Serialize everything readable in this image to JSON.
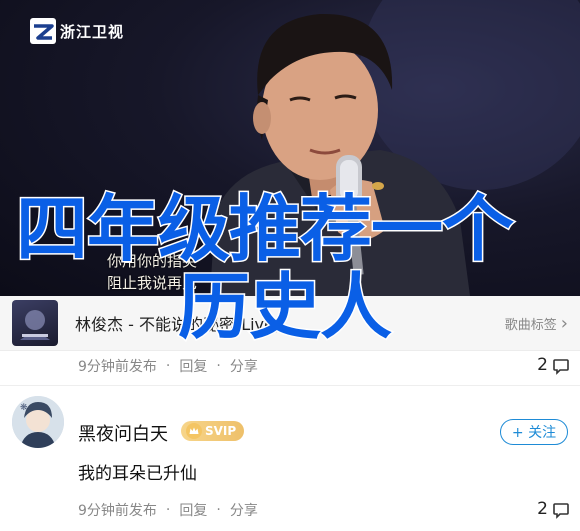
{
  "hero": {
    "logo_text": "浙江卫视",
    "subtitle_line1": "你用你的指尖",
    "subtitle_line2": "阻止我说再见",
    "headline_line1": "四年级推荐一个",
    "headline_line2": "历史人"
  },
  "music": {
    "title": "林俊杰 - 不能说的秘密(Live)",
    "action_label": "歌曲标签",
    "chevron": "›",
    "time": "9分钟前发布",
    "reply": "回复",
    "share": "分享",
    "count": "2"
  },
  "post": {
    "username": "黑夜问白天",
    "badge": "SVIP",
    "follow_label": "+ 关注",
    "text": "我的耳朵已升仙",
    "time": "9分钟前发布",
    "reply": "回复",
    "share": "分享",
    "count": "2"
  },
  "colors": {
    "headline": "#0a5fe6",
    "follow": "#1e8bd6",
    "svip": "#eec06a",
    "meta": "#888888"
  },
  "icons": {
    "logo": "zjtv-logo-icon",
    "comment": "comment-icon",
    "chevron": "chevron-right-icon",
    "svip": "crown-icon"
  }
}
